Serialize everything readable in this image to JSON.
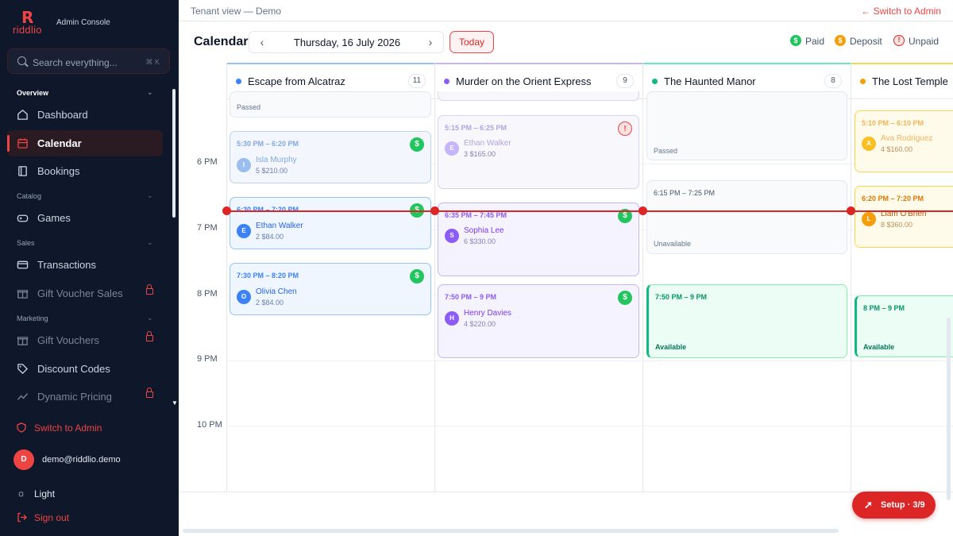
{
  "brand": {
    "name": "riddlio",
    "subtitle": "Admin Console"
  },
  "search": {
    "placeholder": "Search everything...",
    "shortcut": "⌘ K"
  },
  "sidebar": {
    "sections": {
      "overview": "Overview",
      "catalog": "Catalog",
      "sales": "Sales",
      "marketing": "Marketing"
    },
    "items": [
      {
        "label": "Dashboard"
      },
      {
        "label": "Calendar"
      },
      {
        "label": "Bookings"
      },
      {
        "label": "Games"
      },
      {
        "label": "Transactions"
      },
      {
        "label": "Gift Voucher Sales"
      },
      {
        "label": "Gift Vouchers"
      },
      {
        "label": "Discount Codes"
      },
      {
        "label": "Dynamic Pricing"
      }
    ],
    "switch_admin": "Switch to Admin",
    "user": {
      "initial": "D",
      "email": "demo@riddlio.demo"
    },
    "theme": "Light",
    "signout": "Sign out"
  },
  "header": {
    "tenant": "Tenant view — Demo",
    "switch_admin": "← Switch to Admin",
    "title": "Calendar",
    "date": "Thursday, 16 July 2026",
    "today": "Today",
    "legend": {
      "paid": "Paid",
      "deposit": "Deposit",
      "unpaid": "Unpaid"
    },
    "prev_glyph": "‹",
    "next_glyph": "›"
  },
  "colors": {
    "accent": "#ef4444",
    "paid": "#22c55e",
    "deposit": "#f59e0b",
    "unpaid": "#dc2626"
  },
  "times": [
    "6 PM",
    "7 PM",
    "8 PM",
    "9 PM",
    "10 PM"
  ],
  "rooms": [
    {
      "name": "Escape from Alcatraz",
      "count": "11",
      "color": "#3b82f6"
    },
    {
      "name": "Murder on the Orient Express",
      "count": "9",
      "color": "#8b5cf6"
    },
    {
      "name": "The Haunted Manor",
      "count": "8",
      "color": "#10b981"
    },
    {
      "name": "The Lost Temple",
      "count": "",
      "color": "#f59e0b"
    }
  ],
  "events": {
    "r0": [
      {
        "status": "Passed"
      },
      {
        "time": "5:30 PM – 6:20 PM",
        "initial": "I",
        "name": "Isla Murphy",
        "meta": "5   $210.00",
        "pay": "$"
      },
      {
        "time": "6:30 PM – 7:20 PM",
        "initial": "E",
        "name": "Ethan Walker",
        "meta": "2   $84.00",
        "pay": "$"
      },
      {
        "time": "7:30 PM – 8:20 PM",
        "initial": "O",
        "name": "Olivia Chen",
        "meta": "2   $84.00",
        "pay": "$"
      }
    ],
    "r1": [
      {
        "time": "5:15 PM – 6:25 PM",
        "initial": "E",
        "name": "Ethan Walker",
        "meta": "3   $165.00",
        "pay": "!"
      },
      {
        "time": "6:35 PM – 7:45 PM",
        "initial": "S",
        "name": "Sophia Lee",
        "meta": "6   $330.00",
        "pay": "$"
      },
      {
        "time": "7:50 PM – 9 PM",
        "initial": "H",
        "name": "Henry Davies",
        "meta": "4   $220.00",
        "pay": "$"
      }
    ],
    "r2": [
      {
        "status": "Passed"
      },
      {
        "time": "6:15 PM – 7:25 PM",
        "status": "Unavailable"
      },
      {
        "time": "7:50 PM – 9 PM",
        "status": "Available"
      }
    ],
    "r3": [
      {
        "time": "5:10 PM – 6:10 PM",
        "initial": "A",
        "name": "Ava Rodriguez",
        "meta": "4   $160.00"
      },
      {
        "time": "6:20 PM – 7:20 PM",
        "initial": "L",
        "name": "Liam O'Brien",
        "meta": "8   $360.00"
      },
      {
        "time": "8 PM – 9 PM",
        "status": "Available"
      }
    ]
  },
  "setup": {
    "label": "Setup · 3/9"
  }
}
